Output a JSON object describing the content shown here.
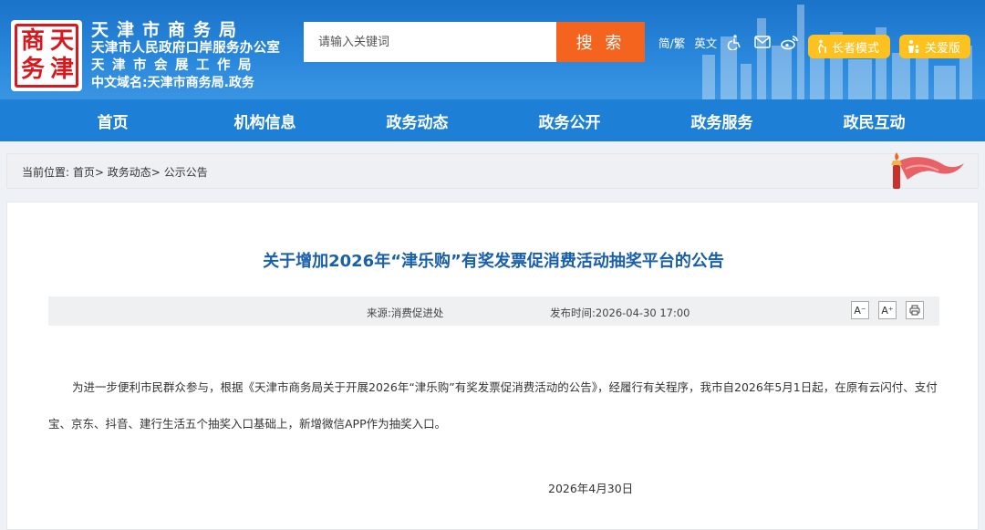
{
  "header": {
    "logo_text": [
      "天",
      "津",
      "商",
      "务"
    ],
    "org_line1": "天津市商务局",
    "org_line2": "天津市人民政府口岸服务办公室",
    "org_line3": "天津市会展工作局",
    "org_line4": "中文域名:天津市商务局.政务",
    "search_placeholder": "请输入关键词",
    "search_button": "搜 索",
    "lang_simplified": "简/繁",
    "lang_english": "英文",
    "elder_mode": "长者模式",
    "care_mode": "关爱版"
  },
  "nav": {
    "items": [
      "首页",
      "机构信息",
      "政务动态",
      "政务公开",
      "政务服务",
      "政民互动"
    ]
  },
  "breadcrumb": {
    "prefix": "当前位置:",
    "home": "首页",
    "sep1": ">",
    "level2": "政务动态",
    "sep2": ">",
    "level3": "公示公告"
  },
  "article": {
    "title": "关于增加2026年“津乐购”有奖发票促消费活动抽奖平台的公告",
    "source": "来源:消费促进处",
    "publish_time": "发布时间:2026-04-30 17:00",
    "font_decrease": "A⁻",
    "font_increase": "A⁺",
    "body": "为进一步便利市民群众参与，根据《天津市商务局关于开展2026年“津乐购”有奖发票促消费活动的公告》，经履行有关程序，我市自2026年5月1日起，在原有云闪付、支付宝、京东、抖音、建行生活五个抽奖入口基础上，新增微信APP作为抽奖入口。",
    "sign_date": "2026年4月30日"
  },
  "colors": {
    "header_blue": "#1a73c9",
    "nav_blue": "#1d80d6",
    "search_orange": "#f5641e",
    "pill_yellow": "#fdc21f",
    "title_blue": "#1a5faa",
    "seal_red": "#d7191f"
  }
}
